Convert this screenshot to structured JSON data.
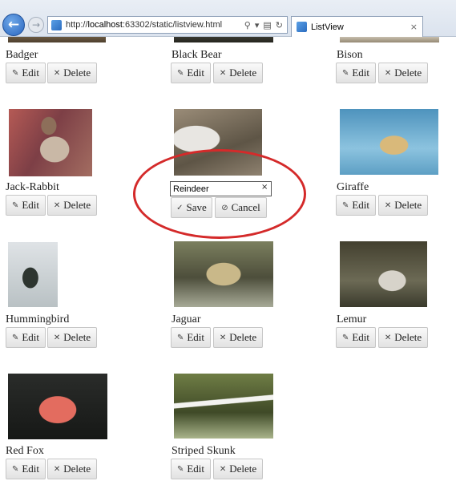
{
  "browser": {
    "url_prefix": "http://",
    "url_host": "localhost",
    "url_rest": ":63302/static/listview.html",
    "tab_title": "ListView",
    "search_glyph": "⚲",
    "dropdown_glyph": "▾",
    "refresh_glyph": "↻",
    "compat_glyph": "▤",
    "close_glyph": "×",
    "back_glyph": "←",
    "forward_glyph": "→"
  },
  "labels": {
    "edit": "Edit",
    "delete": "Delete",
    "save": "Save",
    "cancel": "Cancel",
    "edit_glyph": "✎",
    "delete_glyph": "✕",
    "save_glyph": "✓",
    "cancel_glyph": "⊘",
    "clear_glyph": "×"
  },
  "animals": [
    {
      "name": "Badger",
      "photo": "badger-photo"
    },
    {
      "name": "Black Bear",
      "photo": "black-bear-photo"
    },
    {
      "name": "Bison",
      "photo": "bison-photo"
    },
    {
      "name": "Jack-Rabbit",
      "photo": "jack-rabbit-photo"
    },
    {
      "name": "Reindeer",
      "photo": "reindeer-photo",
      "editing": true
    },
    {
      "name": "Giraffe",
      "photo": "giraffe-photo"
    },
    {
      "name": "Hummingbird",
      "photo": "hummingbird-photo"
    },
    {
      "name": "Jaguar",
      "photo": "jaguar-photo"
    },
    {
      "name": "Lemur",
      "photo": "lemur-photo"
    },
    {
      "name": "Red Fox",
      "photo": "red-fox-photo"
    },
    {
      "name": "Striped Skunk",
      "photo": "striped-skunk-photo"
    }
  ],
  "colors": {
    "highlight": "#d42a2a",
    "browser_accent": "#2a66c0"
  }
}
